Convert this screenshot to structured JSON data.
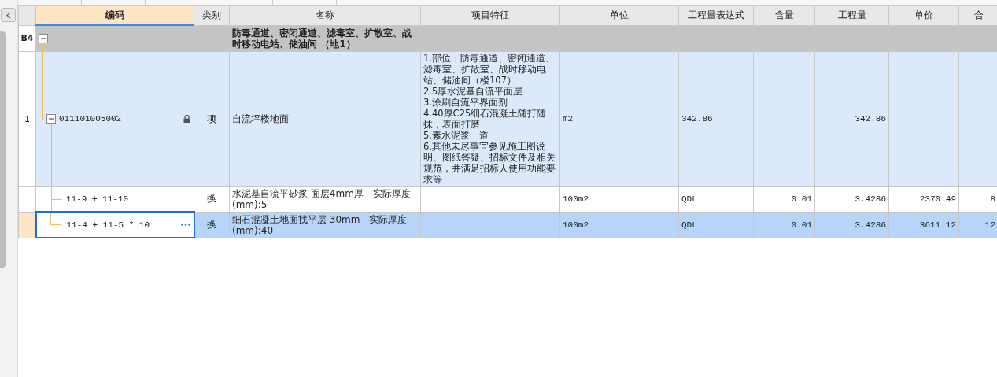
{
  "columns": [
    {
      "label": "编码",
      "selected": true
    },
    {
      "label": "类别",
      "selected": false
    },
    {
      "label": "名称",
      "selected": false
    },
    {
      "label": "项目特征",
      "selected": false
    },
    {
      "label": "单位",
      "selected": false
    },
    {
      "label": "工程量表达式",
      "selected": false
    },
    {
      "label": "含量",
      "selected": false
    },
    {
      "label": "工程量",
      "selected": false
    },
    {
      "label": "单价",
      "selected": false
    },
    {
      "label": "合",
      "selected": false
    }
  ],
  "rows": [
    {
      "kind": "group",
      "number": "B4",
      "expanded": true,
      "selected": false,
      "name": "防毒通道、密闭通道、滤毒室、扩散室、战时移动电站、储油间 （地1）"
    },
    {
      "kind": "item",
      "number": "1",
      "expanded": true,
      "selected": false,
      "locked": true,
      "code": "011101005002",
      "type": "项",
      "name": "自流坪楼地面",
      "features": [
        "1.部位：防毒通道、密闭通道、滤毒室、扩散室、战时移动电站、储油间（楼107）",
        "2.5厚水泥基自流平面层",
        "3.涂刷自流平界面剂",
        "4.40厚C25细石混凝土随打随抹，表面打磨",
        "5.素水泥浆一道",
        "6.其他未尽事宜参见施工图说明、图纸答疑、招标文件及相关规范，并满足招标人使用功能要求等"
      ],
      "unit": "m2",
      "expression": "342.86",
      "quantity": "342.86"
    },
    {
      "kind": "sub",
      "selected": false,
      "code": "11-9 + 11-10",
      "type": "换",
      "name": "水泥基自流平砂浆 面层4mm厚　实际厚度(mm):5",
      "unit": "100m2",
      "expression": "QDL",
      "content": "0.01",
      "quantity": "3.4286",
      "price": "2370.49",
      "total": "8"
    },
    {
      "kind": "sub",
      "selected": true,
      "code": "11-4 + 11-5 * 10",
      "type": "换",
      "name": "细石混凝土地面找平层 30mm　实际厚度(mm):40",
      "unit": "100m2",
      "expression": "QDL",
      "content": "0.01",
      "quantity": "3.4286",
      "price": "3611.12",
      "total": "12"
    }
  ]
}
